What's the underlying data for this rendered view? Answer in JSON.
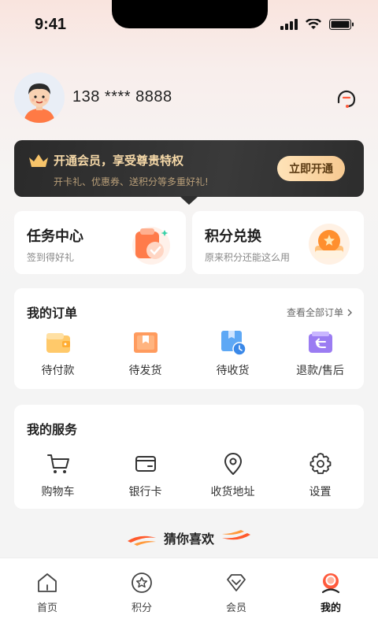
{
  "status_bar": {
    "time": "9:41"
  },
  "profile": {
    "phone": "138 **** 8888"
  },
  "vip": {
    "title": "开通会员，享受尊贵特权",
    "subtitle": "开卡礼、优惠券、送积分等多重好礼!",
    "button": "立即开通"
  },
  "features": [
    {
      "title": "任务中心",
      "subtitle": "签到得好礼",
      "icon": "task-icon"
    },
    {
      "title": "积分兑换",
      "subtitle": "原来积分还能这么用",
      "icon": "points-exchange-icon"
    }
  ],
  "orders": {
    "title": "我的订单",
    "view_all": "查看全部订单",
    "items": [
      {
        "label": "待付款",
        "icon": "wallet-icon"
      },
      {
        "label": "待发货",
        "icon": "package-icon"
      },
      {
        "label": "待收货",
        "icon": "delivery-box-icon"
      },
      {
        "label": "退款/售后",
        "icon": "refund-icon"
      }
    ]
  },
  "services": {
    "title": "我的服务",
    "items": [
      {
        "label": "购物车",
        "icon": "cart-icon"
      },
      {
        "label": "银行卡",
        "icon": "card-icon"
      },
      {
        "label": "收货地址",
        "icon": "location-icon"
      },
      {
        "label": "设置",
        "icon": "gear-icon"
      }
    ]
  },
  "recommend": {
    "title": "猜你喜欢"
  },
  "tabs": [
    {
      "label": "首页",
      "icon": "home-icon"
    },
    {
      "label": "积分",
      "icon": "star-icon"
    },
    {
      "label": "会员",
      "icon": "diamond-icon"
    },
    {
      "label": "我的",
      "icon": "profile-icon",
      "active": true
    }
  ],
  "colors": {
    "accent": "#ff6b3d",
    "vip_gold": "#f6d9a8",
    "tab_active": "#111111"
  }
}
